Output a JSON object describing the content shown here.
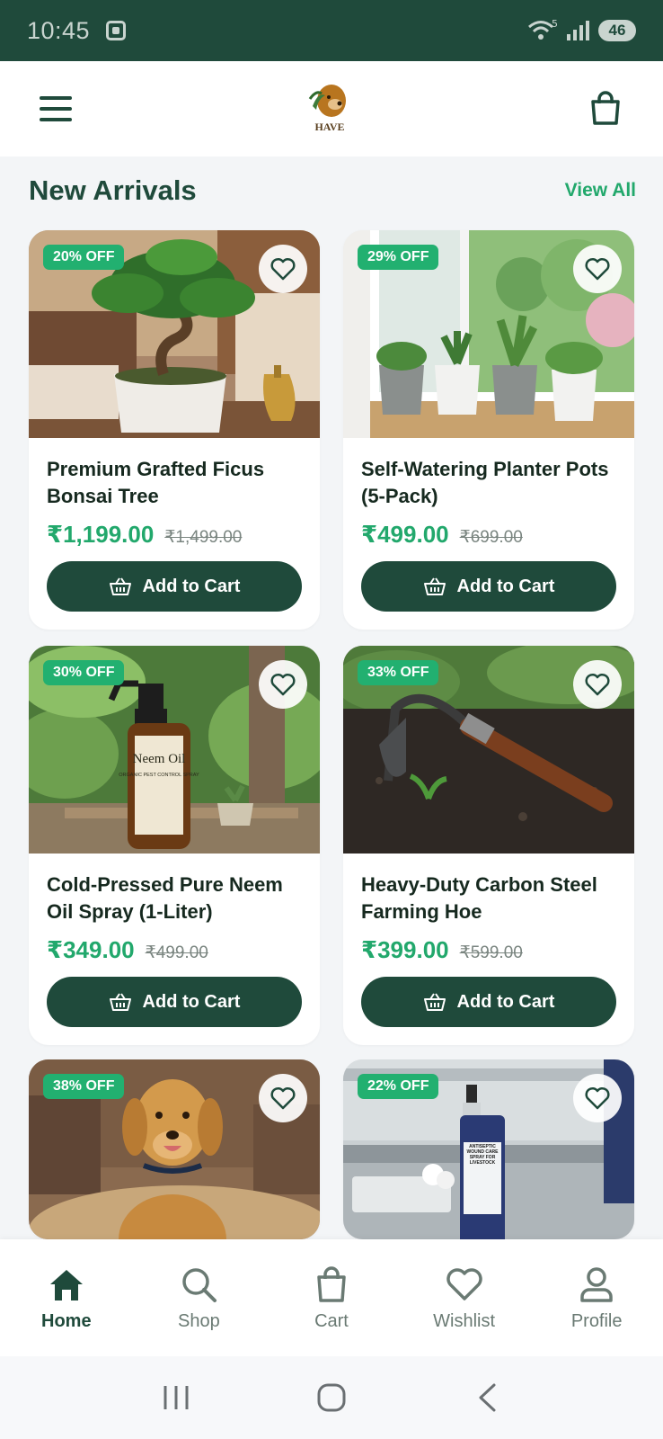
{
  "status_bar": {
    "time": "10:45",
    "wifi_sup": "5",
    "battery": "46"
  },
  "header": {
    "logo_text": "HAVE",
    "menu_icon": "hamburger-icon",
    "bag_icon": "shopping-bag-icon"
  },
  "section": {
    "title": "New Arrivals",
    "view_all": "View All"
  },
  "products": [
    {
      "badge": "20% OFF",
      "title": "Premium Grafted Ficus Bonsai Tree",
      "price": "₹1,199.00",
      "old_price": "₹1,499.00",
      "cta": "Add to Cart"
    },
    {
      "badge": "29% OFF",
      "title": "Self-Watering Planter Pots (5-Pack)",
      "price": "₹499.00",
      "old_price": "₹699.00",
      "cta": "Add to Cart"
    },
    {
      "badge": "30% OFF",
      "title": "Cold-Pressed Pure Neem Oil Spray (1-Liter)",
      "price": "₹349.00",
      "old_price": "₹499.00",
      "cta": "Add to Cart",
      "bottle_label": "Neem Oil",
      "bottle_sub": "ORGANIC PEST CONTROL SPRAY"
    },
    {
      "badge": "33% OFF",
      "title": "Heavy-Duty Carbon Steel Farming Hoe",
      "price": "₹399.00",
      "old_price": "₹599.00",
      "cta": "Add to Cart"
    },
    {
      "badge": "38% OFF"
    },
    {
      "badge": "22% OFF",
      "spray_label": "ANTISEPTIC WOUND CARE SPRAY FOR LIVESTOCK"
    }
  ],
  "bottom_nav": [
    {
      "label": "Home",
      "icon": "home-icon",
      "active": true
    },
    {
      "label": "Shop",
      "icon": "search-icon"
    },
    {
      "label": "Cart",
      "icon": "shopping-bag-icon"
    },
    {
      "label": "Wishlist",
      "icon": "heart-icon"
    },
    {
      "label": "Profile",
      "icon": "user-icon"
    }
  ],
  "colors": {
    "primary": "#1f4a3b",
    "accent": "#22a86c",
    "badge": "#22b070"
  }
}
